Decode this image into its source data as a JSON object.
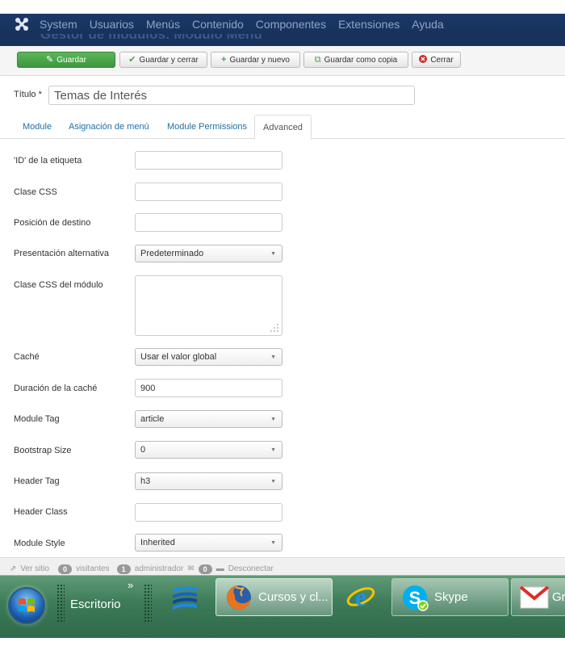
{
  "topnav": {
    "items": [
      "System",
      "Usuarios",
      "Menús",
      "Contenido",
      "Componentes",
      "Extensiones",
      "Ayuda"
    ],
    "page_heading": "Gestor de módulos: Módulo Menú"
  },
  "toolbar": {
    "save": "Guardar",
    "save_close": "Guardar y cerrar",
    "save_new": "Guardar y nuevo",
    "save_copy": "Guardar como copia",
    "close": "Cerrar"
  },
  "title_field": {
    "label": "Título *",
    "value": "Temas de Interés"
  },
  "tabs": [
    "Module",
    "Asignación de menú",
    "Module Permissions",
    "Advanced"
  ],
  "active_tab": "Advanced",
  "form": {
    "tag_id": {
      "label": "'ID' de la etiqueta",
      "value": ""
    },
    "css_class": {
      "label": "Clase CSS",
      "value": ""
    },
    "target_position": {
      "label": "Posición de destino",
      "value": ""
    },
    "alt_layout": {
      "label": "Presentación alternativa",
      "value": "Predeterminado"
    },
    "module_css": {
      "label": "Clase CSS del módulo",
      "value": ""
    },
    "cache": {
      "label": "Caché",
      "value": "Usar el valor global"
    },
    "cache_time": {
      "label": "Duración de la caché",
      "value": "900"
    },
    "module_tag": {
      "label": "Module Tag",
      "value": "article"
    },
    "bootstrap_size": {
      "label": "Bootstrap Size",
      "value": "0"
    },
    "header_tag": {
      "label": "Header Tag",
      "value": "h3"
    },
    "header_class": {
      "label": "Header Class",
      "value": ""
    },
    "module_style": {
      "label": "Module Style",
      "value": "Inherited"
    }
  },
  "statusbar": {
    "view_site": "Ver sitio",
    "visitors_count": "0",
    "visitors_label": "visitantes",
    "admins_count": "1",
    "admins_label": "administrador",
    "messages_count": "0",
    "logout": "Desconectar"
  },
  "taskbar": {
    "desktop": "Escritorio",
    "firefox_window": "Cursos y cl...",
    "skype": "Skype",
    "gmail_partial": "Gr"
  },
  "colors": {
    "nav_bg": "#17325c",
    "primary_green": "#46a546",
    "link_blue": "#1f6fa8",
    "taskbar_green": "#3c7a58"
  }
}
